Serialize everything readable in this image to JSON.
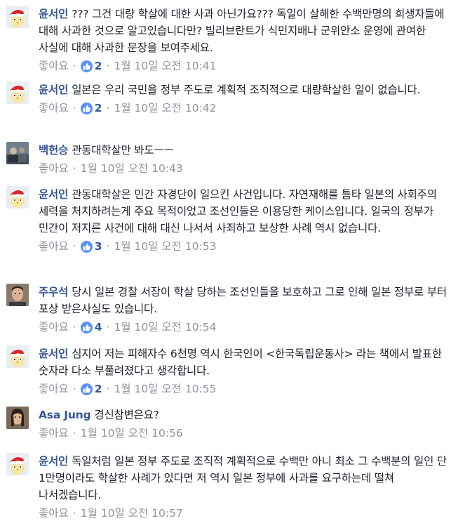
{
  "comments": [
    {
      "author": "윤서인",
      "avatar": "santa-chick",
      "text": "??? 그건 대량 학살에 대한 사과 아닌가요??? 독일이 살해한 수백만명의 희생자들에 대해 사과한 것으로 알고있습니다만? 빌리브란트가 식민지배나 군위안소 운영에 관여한 사실에 대해 사과한 문장을 보여주세요.",
      "like_label": "좋아요",
      "reactions": "2",
      "timestamp": "1월 10일 오전 10:41"
    },
    {
      "author": "윤서인",
      "avatar": "santa-chick",
      "text": "일본은 우리 국민을 정부 주도로 계획적 조직적으로 대량학살한 일이 없습니다.",
      "like_label": "좋아요",
      "reactions": "2",
      "timestamp": "1월 10일 오전 10:42"
    },
    {
      "author": "백헌승",
      "avatar": "photo",
      "text": "관동대학살만 봐도ㅡㅡ",
      "like_label": "좋아요",
      "reactions": "",
      "timestamp": "1월 10일 오전 10:43"
    },
    {
      "author": "윤서인",
      "avatar": "santa-chick",
      "text": "관동대학살은 민간 자경단이 일으킨 사건입니다. 자연재해를 틈타 일본의 사회주의 세력을 처치하려는게 주요 목적이었고 조선인들은 이용당한 케이스입니다. 일국의 정부가 민간이 저지른 사건에 대해 대신 나서서 사죄하고 보상한 사례 역시 없습니다.",
      "like_label": "좋아요",
      "reactions": "3",
      "timestamp": "1월 10일 오전 10:53"
    },
    {
      "author": "주우석",
      "avatar": "face",
      "text": "당시 일본 경찰 서장이 학살 당하는 조선인들을 보호하고 그로 인해 일본 정부로 부터 포상 받은사실도 있습니다.",
      "like_label": "좋아요",
      "reactions": "4",
      "timestamp": "1월 10일 오전 10:54"
    },
    {
      "author": "윤서인",
      "avatar": "santa-chick",
      "text": "심지어 저는 피해자수 6천명 역시 한국인이 <한국독립운동사> 라는 책에서 발표한 숫자라 다소 부풀려졌다고 생각합니다.",
      "like_label": "좋아요",
      "reactions": "2",
      "timestamp": "1월 10일 오전 10:55"
    },
    {
      "author": "Asa Jung",
      "avatar": "face",
      "text": "경신참변은요?",
      "like_label": "좋아요",
      "reactions": "",
      "timestamp": "1월 10일 오전 10:56"
    },
    {
      "author": "윤서인",
      "avatar": "santa-chick",
      "text": "독일처럼 일본 정부 주도로 조직적 계획적으로 수백만 아니 최소 그 수백분의 일인 단 1만명이라도 학살한 사례가 있다면 저 역시 일본 정부에 사과를 요구하는데 떨쳐 나서겠습니다.",
      "like_label": "좋아요",
      "reactions": "",
      "timestamp": "1월 10일 오전 10:57"
    }
  ],
  "colors": {
    "author": "#365899",
    "text": "#1d2129",
    "meta": "#90949c",
    "like_badge": "#5890ff"
  }
}
